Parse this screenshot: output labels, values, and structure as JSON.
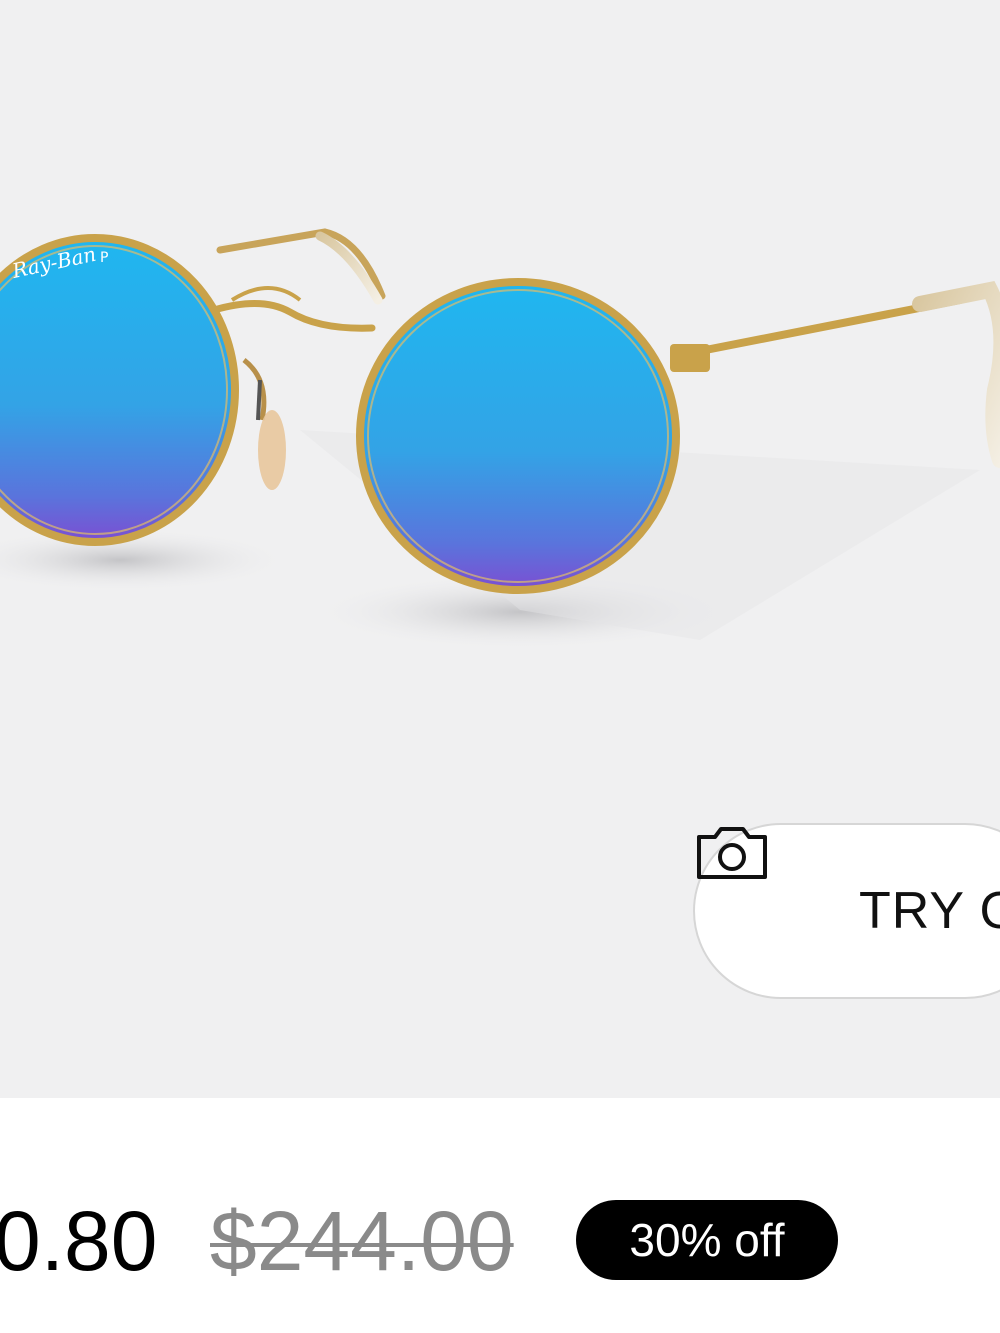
{
  "product": {
    "image_alt": "round sunglasses with gold frame and blue mirrored lenses",
    "logo_icon": "ray-ban-logo-icon"
  },
  "try_on": {
    "label": "TRY O",
    "icon": "camera-icon"
  },
  "pricing": {
    "current_price": "0.80",
    "original_price": "$244.00",
    "discount_badge": "30% off"
  },
  "colors": {
    "image_background": "#f0f0f1",
    "badge_background": "#000000",
    "original_price_text": "#8a8a8a",
    "frame_gold": "#c9a24a",
    "lens_blue": "#2fa6e3",
    "lens_violet": "#7a56d6"
  }
}
